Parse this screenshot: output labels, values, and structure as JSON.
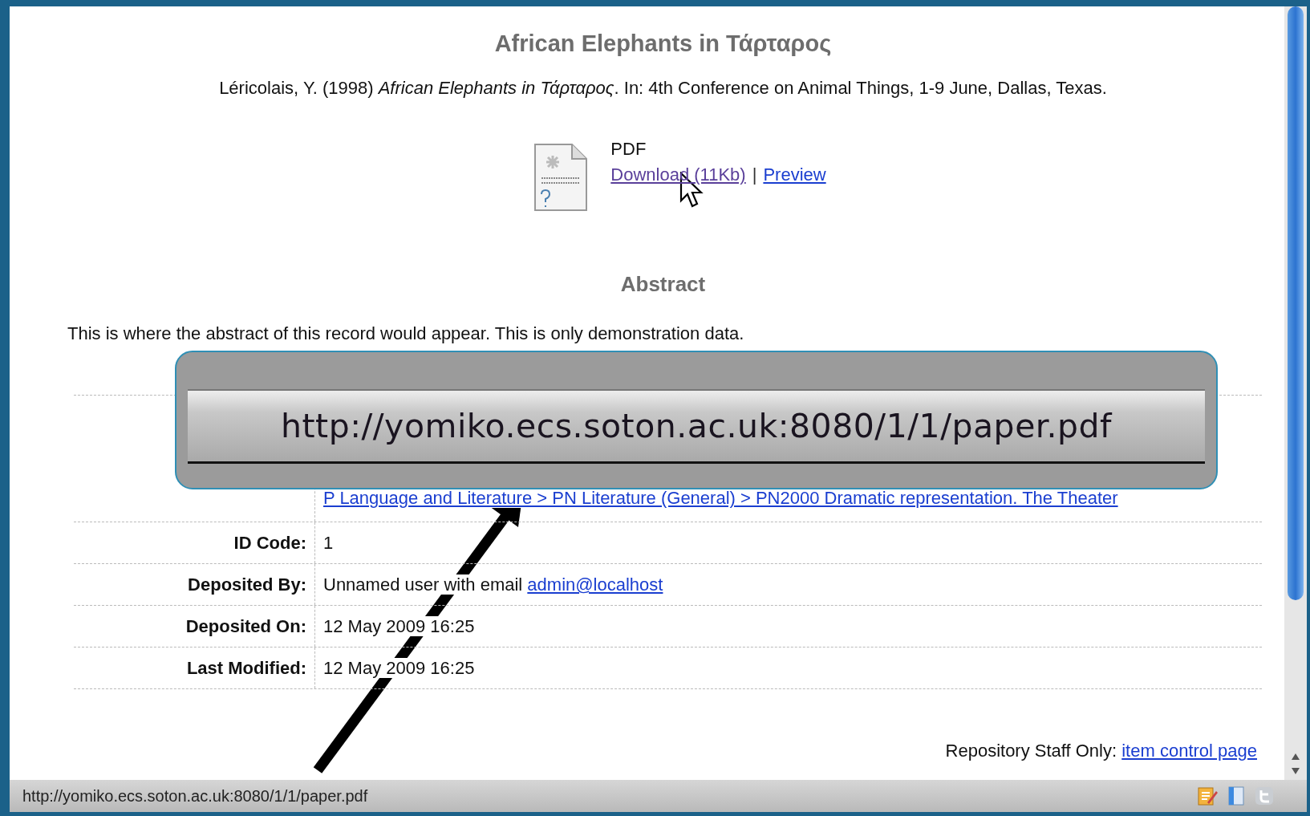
{
  "page": {
    "title": "African Elephants in Τάρταρος",
    "citation": "Léricolais, Y. (1998) *African Elephants in Τάρταρος*. In: 4th Conference on Animal Things, 1-9 June, Dallas, Texas.",
    "document": {
      "format": "PDF",
      "download_link": "Download (11Kb)",
      "separator": "|",
      "preview_link": "Preview"
    },
    "abstract_heading": "Abstract",
    "abstract": "This is where the abstract of this record would appear. This is only demonstration data.",
    "details": [
      {
        "parts": [
          {
            "text": "P Language and Literature > PN Literature (General) > PN2000 Dramatic representation. The Theater",
            "kind": "link"
          }
        ]
      },
      {
        "label": "ID Code:",
        "parts": [
          {
            "text": "1",
            "kind": "text"
          }
        ]
      },
      {
        "label": "Deposited By:",
        "parts": [
          {
            "text": "Unnamed user with email ",
            "kind": "text"
          },
          {
            "text": "admin@localhost",
            "kind": "link"
          }
        ]
      },
      {
        "label": "Deposited On:",
        "parts": [
          {
            "text": "12 May 2009 16:25",
            "kind": "text"
          }
        ]
      },
      {
        "label": "Last Modified:",
        "parts": [
          {
            "text": "12 May 2009 16:25",
            "kind": "text"
          }
        ]
      }
    ],
    "staff_note": {
      "label": "Repository Staff Only:",
      "link": "item control page"
    }
  },
  "callout": {
    "url": "http://yomiko.ecs.soton.ac.uk:8080/1/1/paper.pdf"
  },
  "status_bar": {
    "url": "http://yomiko.ecs.soton.ac.uk:8080/1/1/paper.pdf"
  }
}
